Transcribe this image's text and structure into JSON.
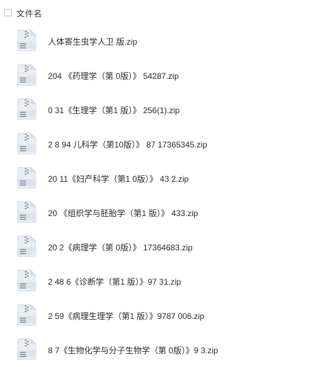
{
  "header": {
    "column_label": "文件名"
  },
  "files": [
    {
      "name": "人体寄生虫学人卫  版.zip",
      "icon": "zip-file-icon"
    },
    {
      "name": "204   《药理学（第  0版）》               54287.zip",
      "icon": "zip-file-icon"
    },
    {
      "name": "0   31《生理学（第1  版）》               256(1).zip",
      "icon": "zip-file-icon"
    },
    {
      "name": "2   8  94  儿科学（第10版）》    87  17365345.zip",
      "icon": "zip-file-icon"
    },
    {
      "name": "20   11《妇产科学（第1  0版）》           43  2.zip",
      "icon": "zip-file-icon"
    },
    {
      "name": "20    《组织学与胚胎学（第1  版）》             433.zip",
      "icon": "zip-file-icon"
    },
    {
      "name": "20   2《病理学（第  0版）》        17364683.zip",
      "icon": "zip-file-icon"
    },
    {
      "name": "2  48  6《诊断学（第1  版）》97            31.zip",
      "icon": "zip-file-icon"
    },
    {
      "name": "2   59《病理生理学（第1  版）》9787          006.zip",
      "icon": "zip-file-icon"
    },
    {
      "name": "   8  7《生物化学与分子生物学（第  0版）》9              3.zip",
      "icon": "zip-file-icon"
    }
  ],
  "colors": {
    "icon_body": "#e8edf3",
    "icon_fold": "#d4dce6",
    "icon_zipper": "#9aa6b4",
    "text": "#2b2b2b"
  }
}
